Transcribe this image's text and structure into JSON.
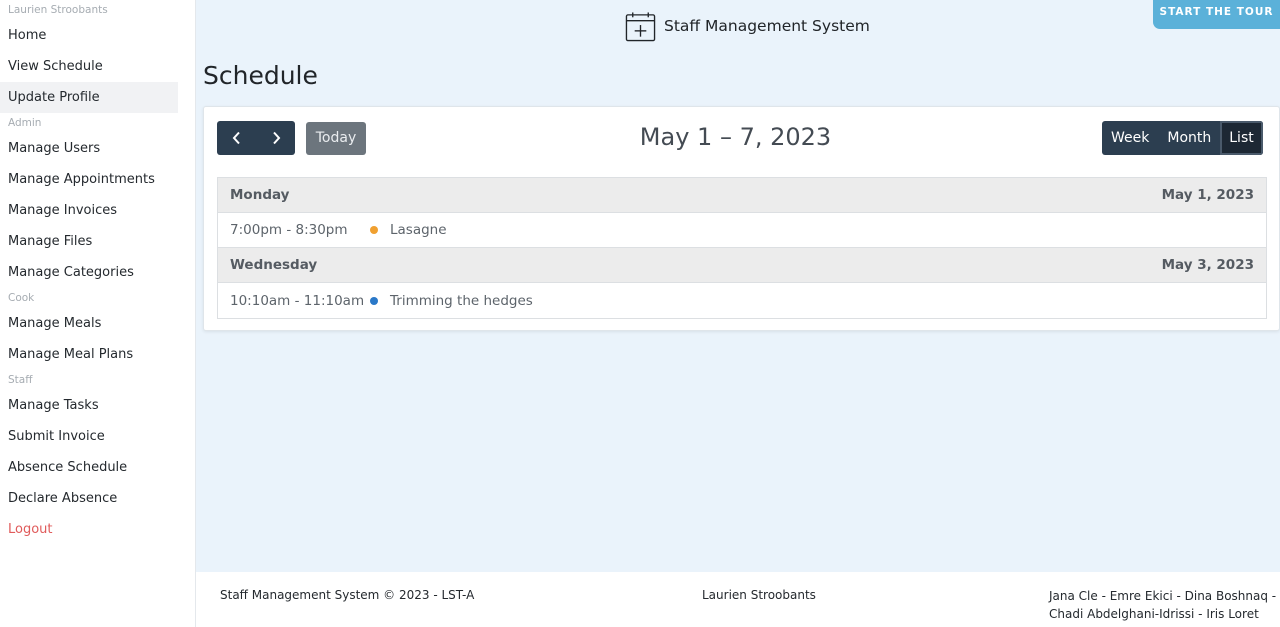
{
  "sidebar": {
    "user_name": "Laurien Stroobants",
    "items_main": [
      "Home",
      "View Schedule",
      "Update Profile"
    ],
    "section_admin": "Admin",
    "items_admin": [
      "Manage Users",
      "Manage Appointments",
      "Manage Invoices",
      "Manage Files",
      "Manage Categories"
    ],
    "section_cook": "Cook",
    "items_cook": [
      "Manage Meals",
      "Manage Meal Plans"
    ],
    "section_staff": "Staff",
    "items_staff": [
      "Manage Tasks",
      "Submit Invoice",
      "Absence Schedule",
      "Declare Absence"
    ],
    "logout": "Logout",
    "active_item": "Update Profile"
  },
  "header": {
    "brand_title": "Staff Management System",
    "brand_icon": "calendar-plus-icon",
    "tour_button": "START THE TOUR"
  },
  "page": {
    "title": "Schedule"
  },
  "calendar": {
    "prev_icon": "chevron-left-icon",
    "next_icon": "chevron-right-icon",
    "today_label": "Today",
    "range_title": "May 1 – 7, 2023",
    "views": [
      "Week",
      "Month",
      "List"
    ],
    "active_view": "List",
    "days": [
      {
        "weekday": "Monday",
        "date": "May 1, 2023",
        "events": [
          {
            "time": "7:00pm - 8:30pm",
            "title": "Lasagne",
            "color": "#f0a030"
          }
        ]
      },
      {
        "weekday": "Wednesday",
        "date": "May 3, 2023",
        "events": [
          {
            "time": "10:10am - 11:10am",
            "title": "Trimming the hedges",
            "color": "#2a78c8"
          }
        ]
      }
    ]
  },
  "footer": {
    "left": "Staff Management System © 2023 - LST-A",
    "center": "Laurien Stroobants",
    "right_line1": "Jana Cle - Emre Ekici - Dina Boshnaq -",
    "right_line2": "Chadi Abdelghani-Idrissi - Iris Loret"
  },
  "colors": {
    "background": "#eaf3fb",
    "nav_dark": "#2c3e50",
    "tour_button": "#5bb1d9",
    "logout": "#e05b5b"
  }
}
